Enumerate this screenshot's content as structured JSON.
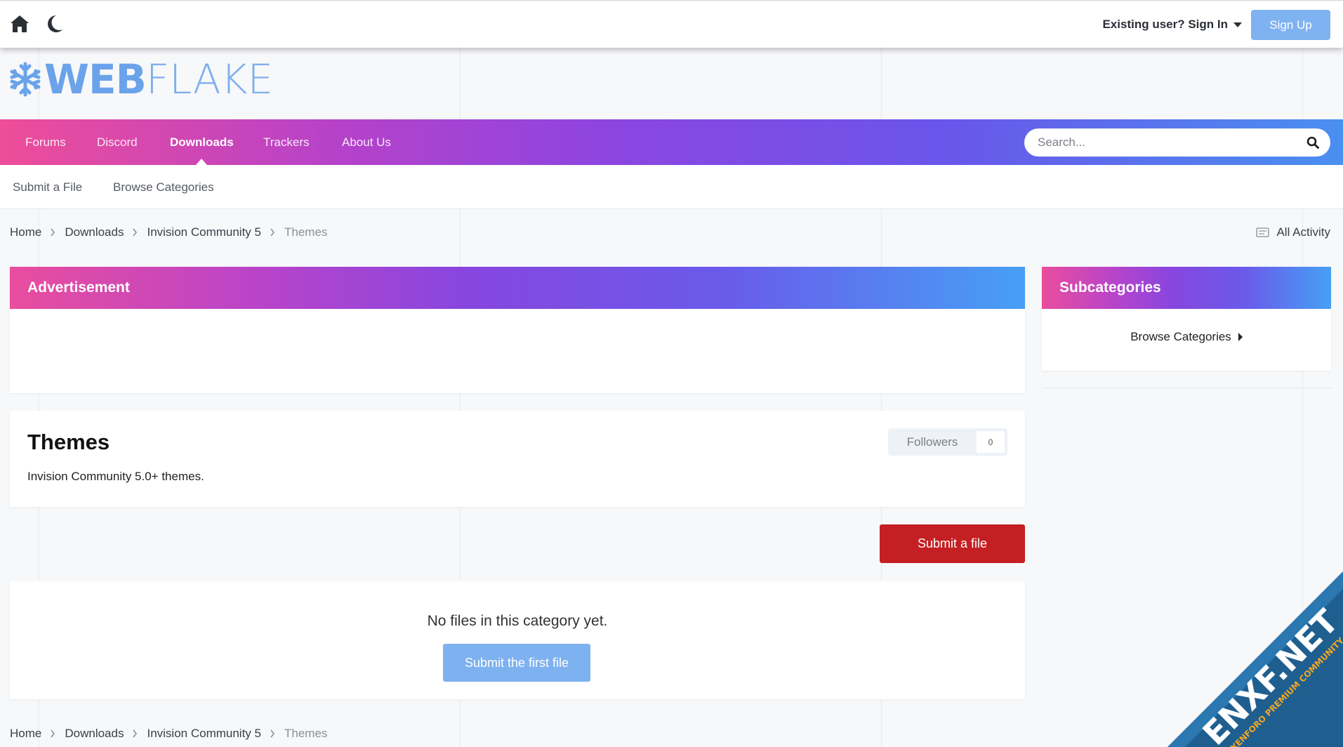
{
  "topbar": {
    "signin_label": "Existing user? Sign In",
    "signup_label": "Sign Up",
    "icons": [
      "home-icon",
      "moon-icon",
      "caret-down-icon"
    ]
  },
  "logo": {
    "part1": "WEB",
    "part2": "FLAKE",
    "icon": "snowflake-icon"
  },
  "nav": {
    "items": [
      {
        "label": "Forums"
      },
      {
        "label": "Discord"
      },
      {
        "label": "Downloads",
        "active": true
      },
      {
        "label": "Trackers"
      },
      {
        "label": "About Us"
      }
    ],
    "search_placeholder": "Search..."
  },
  "subnav": {
    "items": [
      {
        "label": "Submit a File"
      },
      {
        "label": "Browse Categories"
      }
    ]
  },
  "breadcrumb": {
    "items": [
      "Home",
      "Downloads",
      "Invision Community 5",
      "Themes"
    ],
    "all_activity": "All Activity"
  },
  "advertisement": {
    "title": "Advertisement"
  },
  "subcategories": {
    "title": "Subcategories",
    "browse_label": "Browse Categories"
  },
  "category": {
    "title": "Themes",
    "description": "Invision Community 5.0+ themes.",
    "followers_label": "Followers",
    "followers_count": "0"
  },
  "actions": {
    "submit_file_label": "Submit a file"
  },
  "empty_state": {
    "message": "No files in this category yet.",
    "button_label": "Submit the first file"
  },
  "colors": {
    "nav_gradient": [
      "#ee4d99",
      "#8d45e0",
      "#4a90f0"
    ],
    "submit_button": "#c41f23",
    "primary_light": "#7eb1ef",
    "logo": "#6aa3ea"
  },
  "watermark": {
    "main": "ENXF.NET",
    "sub": "XENFORO PREMIUM COMMUNITY"
  }
}
